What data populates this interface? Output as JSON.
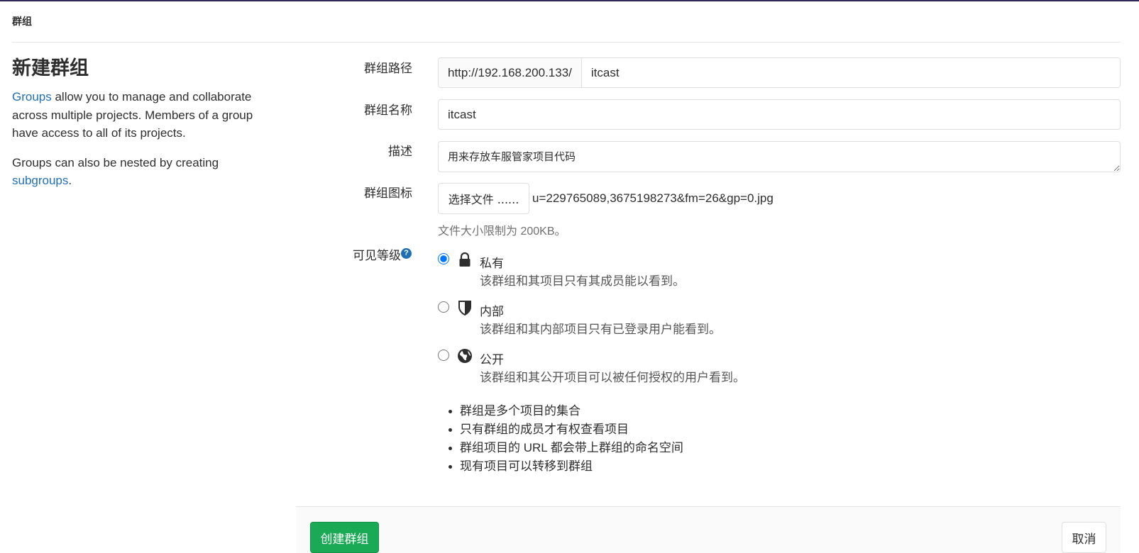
{
  "breadcrumb": "群组",
  "left": {
    "title": "新建群组",
    "para1_link": "Groups",
    "para1_rest": " allow you to manage and collaborate across multiple projects. Members of a group have access to all of its projects.",
    "para2_text": "Groups can also be nested by creating ",
    "para2_link": "subgroups",
    "para2_end": "."
  },
  "form": {
    "path_label": "群组路径",
    "path_prefix": "http://192.168.200.133/",
    "path_value": "itcast",
    "name_label": "群组名称",
    "name_value": "itcast",
    "desc_label": "描述",
    "desc_value": "用来存放车服管家项目代码",
    "avatar_label": "群组图标",
    "avatar_button": "选择文件 ......",
    "avatar_filename": "u=229765089,3675198273&fm=26&gp=0.jpg",
    "avatar_hint": "文件大小限制为 200KB。",
    "visibility_label": "可见等级",
    "help_icon": "?",
    "visibility_options": [
      {
        "title": "私有",
        "desc": "该群组和其项目只有其成员能以看到。",
        "icon": "lock-icon",
        "checked": true
      },
      {
        "title": "内部",
        "desc": "该群组和其内部项目只有已登录用户能看到。",
        "icon": "shield-icon",
        "checked": false
      },
      {
        "title": "公开",
        "desc": "该群组和其公开项目可以被任何授权的用户看到。",
        "icon": "globe-icon",
        "checked": false
      }
    ],
    "info_items": [
      "群组是多个项目的集合",
      "只有群组的成员才有权查看项目",
      "群组项目的 URL 都会带上群组的命名空间",
      "现有项目可以转移到群组"
    ]
  },
  "actions": {
    "create_label": "创建群组",
    "cancel_label": "取消"
  },
  "colors": {
    "primary": "#1aaa55",
    "link": "#1f6fb5",
    "top_bar": "#2f2a5b"
  }
}
